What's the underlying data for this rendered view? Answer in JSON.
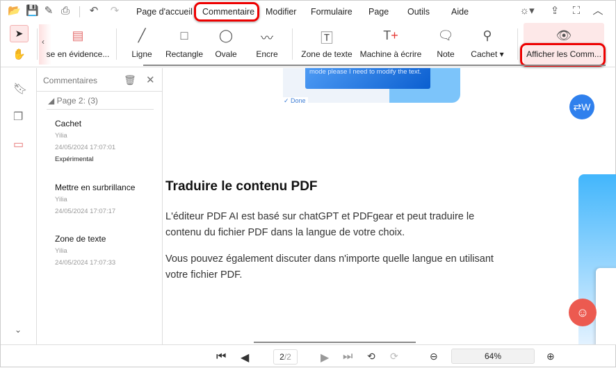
{
  "menu": {
    "items": [
      "Page d'accueil",
      "Commentaire",
      "Modifier",
      "Formulaire",
      "Page",
      "Outils",
      "Aide"
    ],
    "active": "Commentaire"
  },
  "toolbar": {
    "highlight": "se en évidence...",
    "line": "Ligne",
    "rectangle": "Rectangle",
    "oval": "Ovale",
    "ink": "Encre",
    "textbox": "Zone de texte",
    "typewriter": "Machine à écrire",
    "note": "Note",
    "stamp": "Cachet",
    "show_comments": "Afficher les Comm..."
  },
  "panel": {
    "title": "Commentaires",
    "group": "Page 2: (3)",
    "items": [
      {
        "title": "Cachet",
        "author": "Yilia",
        "date": "24/05/2024 17:07:01",
        "extra": "Expérimental"
      },
      {
        "title": "Mettre en surbrillance",
        "author": "Yilia",
        "date": "24/05/2024 17:07:17"
      },
      {
        "title": "Zone de texte",
        "author": "Yilia",
        "date": "24/05/2024 17:07:33"
      }
    ]
  },
  "doc": {
    "bubble": "mode please I need to modify the text.",
    "done": "✓ Done",
    "heading": "Traduire le contenu PDF",
    "p1": "L'éditeur PDF AI est basé sur chatGPT et PDFgear et peut traduire le contenu du fichier PDF dans la langue de votre choix.",
    "p2": "Vous pouvez également discuter dans n'importe quelle langue en utilisant votre fichier PDF."
  },
  "bottom": {
    "page": "2",
    "total": "/2",
    "zoom": "64%"
  },
  "colors": {
    "accent": "#e53935",
    "highlight_bg": "#fde8e8",
    "blue": "#2f80ed"
  }
}
